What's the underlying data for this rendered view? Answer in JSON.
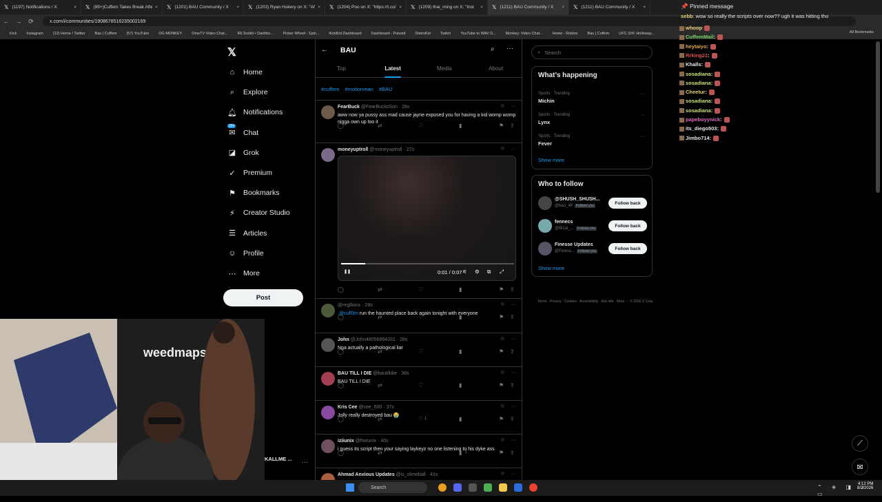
{
  "browser": {
    "tabs": [
      {
        "label": "(1197) Notifications / X",
        "icon": "x-logo-icon",
        "active": false
      },
      {
        "label": "(99+)Cuffem Takes Break After",
        "icon": "kick-icon",
        "active": false
      },
      {
        "label": "(1201) BAU Community / X",
        "icon": "x-logo-icon",
        "active": false
      },
      {
        "label": "(1203) Ryan Hukery on X: \"Afte",
        "icon": "x-logo-icon",
        "active": false
      },
      {
        "label": "(1204) Poo on X: \"https://t.co/",
        "icon": "x-logo-icon",
        "active": false
      },
      {
        "label": "(1209) thai_ming on X: \"Inst",
        "icon": "x-logo-icon",
        "active": false
      },
      {
        "label": "(1211) BAU Community / X",
        "icon": "x-logo-icon",
        "active": true
      },
      {
        "label": "(1211) BAU Community / X",
        "icon": "x-logo-icon",
        "active": false
      }
    ],
    "url": "x.com/i/communities/1908678516235002169",
    "bookmarks": [
      "Kick",
      "Instagram",
      "(12) Home / Twitter",
      "Bau | Cuffem",
      "(57) YouTube",
      "OG MONKEY",
      "OmeTV Video Chat...",
      "IRLToolkit • Dashbo...",
      "Picker Wheel - Spin...",
      "KickBot Dashboard",
      "Dashboard - Pulsoid",
      "DistroKid",
      "Twitch",
      "YouTube to WAV D...",
      "Monkey: Video Chat...",
      "Home - Roblox",
      "Bau | Cuffem",
      "UFC 326: Holloway..."
    ],
    "bookmarks_end": "All Bookmarks"
  },
  "sidebar": {
    "nav": [
      {
        "label": "Home",
        "icon": "home-icon"
      },
      {
        "label": "Explore",
        "icon": "search-icon"
      },
      {
        "label": "Notifications",
        "icon": "bell-icon"
      },
      {
        "label": "Chat",
        "icon": "chat-icon",
        "badge": "20+"
      },
      {
        "label": "Grok",
        "icon": "grok-icon"
      },
      {
        "label": "Premium",
        "icon": "premium-icon"
      },
      {
        "label": "Bookmarks",
        "icon": "bookmark-icon"
      },
      {
        "label": "Creator Studio",
        "icon": "creator-studio-icon"
      },
      {
        "label": "Articles",
        "icon": "articles-icon"
      },
      {
        "label": "Profile",
        "icon": "profile-icon"
      },
      {
        "label": "More",
        "icon": "more-icon"
      }
    ],
    "post_label": "Post",
    "user": "KALLME ..."
  },
  "community": {
    "title": "BAU",
    "tabs": [
      "Top",
      "Latest",
      "Media",
      "About"
    ],
    "active_tab": "Latest",
    "tags": [
      "#cuffem",
      "#motionman",
      "#BAU"
    ]
  },
  "posts": [
    {
      "name": "FearBuck",
      "handle": "@FearBucksSon",
      "time": "26s",
      "text": "aww now ya pussy ass mad cause jayne exposed you for having a kid womp womp nigga own up too it",
      "likes": ""
    },
    {
      "name": "moneyuptroll",
      "handle": "@moneyuptroll",
      "time": "27s",
      "text": "",
      "video": {
        "time": "0:01 / 0:07",
        "progress": 0.14
      }
    },
    {
      "name": "",
      "handle": "@regllions",
      "time": "28s",
      "mention": ".@cuff3m",
      "text": " run the haunted place back again tonight with everyone"
    },
    {
      "name": "John",
      "handle": "@John48056864331",
      "time": "28s",
      "text": "Nga actually a pathological liar"
    },
    {
      "name": "BAU TILL I DIE",
      "handle": "@bautilldie",
      "time": "36s",
      "text": "BAU TILL I DIE"
    },
    {
      "name": "Kris Cee",
      "handle": "@cee_600",
      "time": "37s",
      "text": "Jolly really destroyed bau 😭",
      "likes": "1"
    },
    {
      "name": "iziiunix",
      "handle": "@ftwiunix",
      "time": "40s",
      "text": "i guess its script then your saying laykeyz no one listening to his dyke ass",
      "views": "1"
    },
    {
      "name": "Ahmad Anxious Updates",
      "handle": "@is_slimeball",
      "time": "41s",
      "text": ""
    }
  ],
  "right": {
    "search_placeholder": "Search",
    "happening_title": "What’s happening",
    "trends": [
      {
        "context": "Sports · Trending",
        "name": "Michin"
      },
      {
        "context": "Sports · Trending",
        "name": "Lynx"
      },
      {
        "context": "Sports · Trending",
        "name": "Fever"
      }
    ],
    "show_more": "Show more",
    "wtf_title": "Who to follow",
    "who_to_follow": [
      {
        "name": "@SHUSH_SHUSH...",
        "handle": "@bau_4lf",
        "follows_you": "Follows you",
        "button": "Follow back"
      },
      {
        "name": "fennecs",
        "handle": "@Bl1al_...",
        "follows_you": "Follows you",
        "button": "Follow back"
      },
      {
        "name": "Finesse Updates",
        "handle": "@Finess...",
        "follows_you": "Follows you",
        "button": "Follow back"
      }
    ],
    "footer": "Terms · Privacy · Cookies · Accessibility · Ads info · More ··· © 2026 X Corp."
  },
  "chat": {
    "pinned_title": "Pinned message",
    "pinned_user": "sebb",
    "pinned_text": ": wow so really the scripts over now?? ugh it was hitting tho",
    "lines": [
      {
        "user": "whoop",
        "color": "#e7d27a",
        "text": ""
      },
      {
        "user": "CuffemMail",
        "color": "#7ad16b",
        "text": ":"
      },
      {
        "user": "heytaiyo",
        "color": "#e7a94a",
        "text": ":"
      },
      {
        "user": "Rrking21",
        "color": "#d9534f",
        "text": ":"
      },
      {
        "user": "Khalls",
        "color": "#e7e9ea",
        "text": ":"
      },
      {
        "user": "sosadiana",
        "color": "#c9e27a",
        "text": ":"
      },
      {
        "user": "sosadiana",
        "color": "#c9e27a",
        "text": ":"
      },
      {
        "user": "Cheetur",
        "color": "#e7d27a",
        "text": ":"
      },
      {
        "user": "sosadiana",
        "color": "#c9e27a",
        "text": ":"
      },
      {
        "user": "sosadiana",
        "color": "#c9e27a",
        "text": ":"
      },
      {
        "user": "papeboyynick",
        "color": "#e06ac8",
        "text": ":"
      },
      {
        "user": "its_diego503",
        "color": "#e7e9ea",
        "text": ":"
      },
      {
        "user": "Jimbo714",
        "color": "#e7e9ea",
        "text": ":"
      }
    ]
  },
  "taskbar": {
    "search_label": "Search",
    "time": "4:12 PM",
    "date": "8/2/2026"
  },
  "colors": {
    "accent": "#1d9bf0",
    "bg": "#000000",
    "border": "#2f3336"
  }
}
